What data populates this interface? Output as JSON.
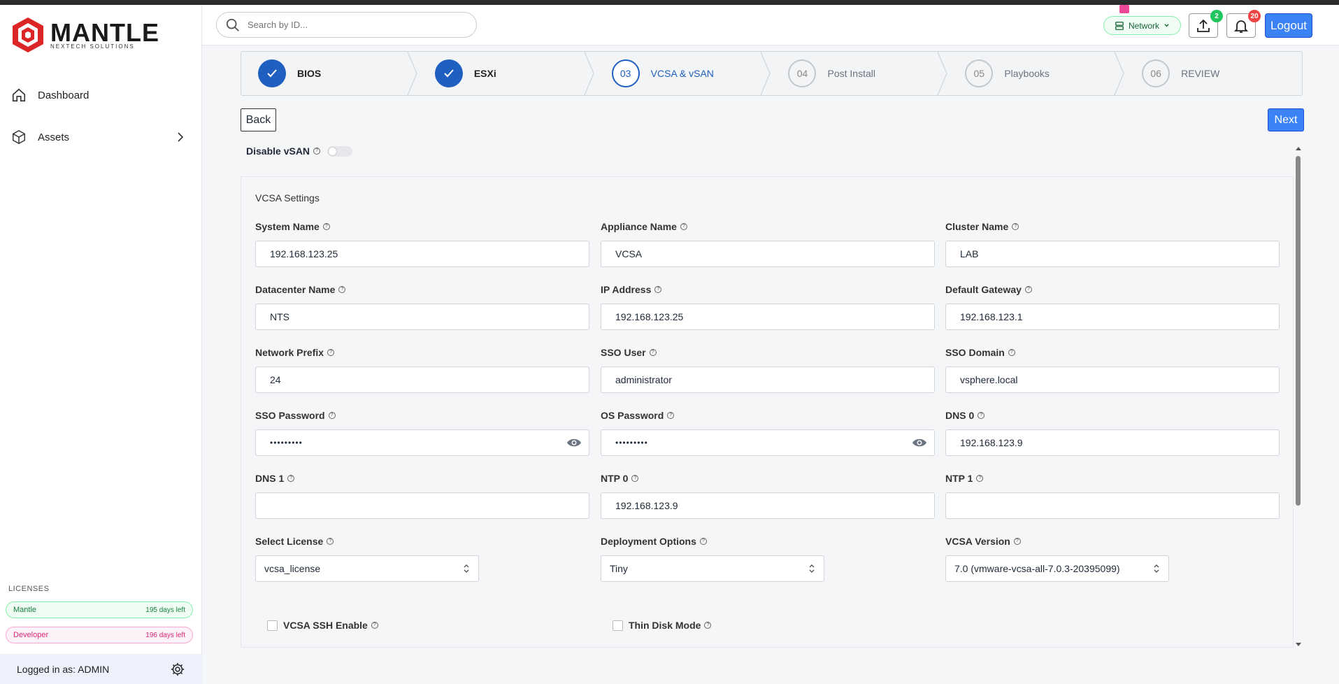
{
  "brand": {
    "title": "MANTLE",
    "subtitle": "NEXTECH SOLUTIONS",
    "color": "#dc2626"
  },
  "sidebar": {
    "items": [
      {
        "label": "Dashboard",
        "icon": "home-icon"
      },
      {
        "label": "Assets",
        "icon": "cube-icon"
      }
    ],
    "licenses_title": "LICENSES",
    "licenses": [
      {
        "name": "Mantle",
        "days": "195 days left"
      },
      {
        "name": "Developer",
        "days": "196 days left"
      }
    ],
    "logged_in": "Logged in as: ADMIN"
  },
  "header": {
    "search_placeholder": "Search by ID...",
    "network_label": "Network",
    "upload_badge": "2",
    "notif_badge": "20",
    "logout_label": "Logout"
  },
  "stepper": {
    "steps": [
      {
        "num": "",
        "label": "BIOS",
        "state": "done"
      },
      {
        "num": "",
        "label": "ESXi",
        "state": "done"
      },
      {
        "num": "03",
        "label": "VCSA & vSAN",
        "state": "current"
      },
      {
        "num": "04",
        "label": "Post Install",
        "state": "todo"
      },
      {
        "num": "05",
        "label": "Playbooks",
        "state": "todo"
      },
      {
        "num": "06",
        "label": "REVIEW",
        "state": "todo"
      }
    ]
  },
  "actions": {
    "back": "Back",
    "next": "Next"
  },
  "vsan": {
    "label": "Disable vSAN",
    "enabled": false
  },
  "vcsa": {
    "title": "VCSA Settings",
    "fields": {
      "system_name": {
        "label": "System Name",
        "value": "192.168.123.25"
      },
      "appliance_name": {
        "label": "Appliance Name",
        "value": "VCSA"
      },
      "cluster_name": {
        "label": "Cluster Name",
        "value": "LAB"
      },
      "datacenter_name": {
        "label": "Datacenter Name",
        "value": "NTS"
      },
      "ip_address": {
        "label": "IP Address",
        "value": "192.168.123.25"
      },
      "default_gateway": {
        "label": "Default Gateway",
        "value": "192.168.123.1"
      },
      "network_prefix": {
        "label": "Network Prefix",
        "value": "24"
      },
      "sso_user": {
        "label": "SSO User",
        "value": "administrator"
      },
      "sso_domain": {
        "label": "SSO Domain",
        "value": "vsphere.local"
      },
      "sso_password": {
        "label": "SSO Password",
        "value": "•••••••••"
      },
      "os_password": {
        "label": "OS Password",
        "value": "•••••••••"
      },
      "dns0": {
        "label": "DNS 0",
        "value": "192.168.123.9"
      },
      "dns1": {
        "label": "DNS 1",
        "value": ""
      },
      "ntp0": {
        "label": "NTP 0",
        "value": "192.168.123.9"
      },
      "ntp1": {
        "label": "NTP 1",
        "value": ""
      },
      "license": {
        "label": "Select License",
        "value": "vcsa_license"
      },
      "deployment": {
        "label": "Deployment Options",
        "value": "Tiny"
      },
      "version": {
        "label": "VCSA Version",
        "value": "7.0 (vmware-vcsa-all-7.0.3-20395099)"
      }
    },
    "ssh_enable": {
      "label": "VCSA SSH Enable",
      "checked": false
    },
    "thin_disk": {
      "label": "Thin Disk Mode",
      "checked": false
    }
  }
}
